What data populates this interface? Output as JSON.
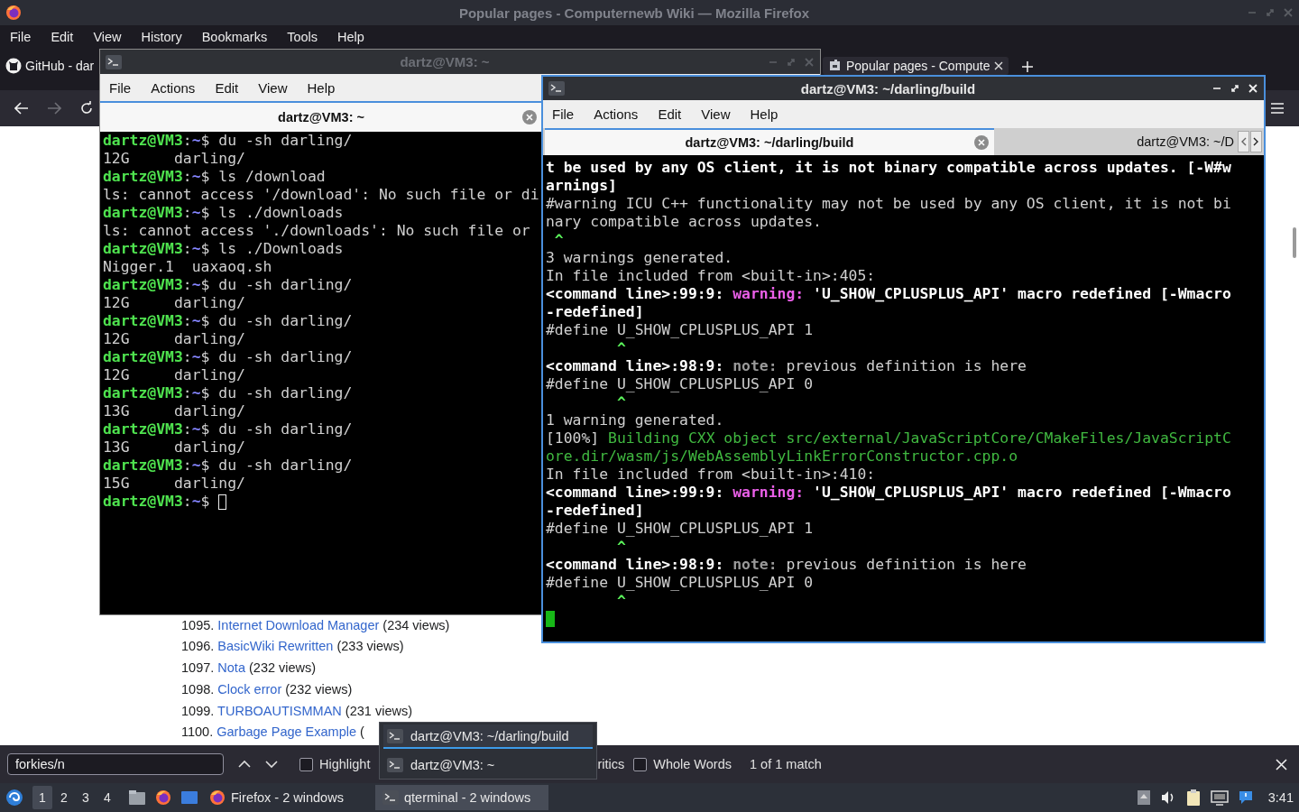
{
  "firefox": {
    "title": "Popular pages - Computernewb Wiki — Mozilla Firefox",
    "menu": [
      "File",
      "Edit",
      "View",
      "History",
      "Bookmarks",
      "Tools",
      "Help"
    ],
    "tabs": [
      {
        "label": "GitHub - dar",
        "kind": "github",
        "selected": false
      },
      {
        "label": "Popular pages - Compute",
        "kind": "wiki",
        "selected": true
      }
    ],
    "nav": {
      "forward_disabled": true
    },
    "page": {
      "items": [
        {
          "number": "1095.",
          "link": "Internet Download Manager",
          "views": "(234 views)"
        },
        {
          "number": "1096.",
          "link": "BasicWiki Rewritten",
          "views": "(233 views)"
        },
        {
          "number": "1097.",
          "link": "Nota",
          "views": "(232 views)"
        },
        {
          "number": "1098.",
          "link": "Clock error",
          "views": "(232 views)"
        },
        {
          "number": "1099.",
          "link": "TURBOAUTISMMAN",
          "views": "(231 views)"
        },
        {
          "number": "1100.",
          "link": "Garbage Page Example",
          "views": "("
        }
      ]
    },
    "find_bar": {
      "value": "forkies/n",
      "highlight": {
        "label": "Highlight",
        "checked": false
      },
      "option_fragment": "ritics",
      "whole_words": {
        "label": "Whole Words",
        "checked": false
      },
      "status": "1 of 1 match"
    }
  },
  "terminals": [
    {
      "title": "dartz@VM3: ~",
      "active": false,
      "menu": [
        "File",
        "Actions",
        "Edit",
        "View",
        "Help"
      ],
      "tabs": [
        {
          "label": "dartz@VM3: ~",
          "selected": true
        }
      ],
      "lines": [
        {
          "segs": [
            {
              "kind": "user",
              "text": "dartz@VM3"
            },
            {
              "kind": "plain",
              "text": ":"
            },
            {
              "kind": "path",
              "text": "~"
            },
            {
              "kind": "plain",
              "text": "$ du -sh darling/"
            }
          ]
        },
        {
          "segs": [
            {
              "kind": "plain",
              "text": "12G     darling/"
            }
          ]
        },
        {
          "segs": [
            {
              "kind": "user",
              "text": "dartz@VM3"
            },
            {
              "kind": "plain",
              "text": ":"
            },
            {
              "kind": "path",
              "text": "~"
            },
            {
              "kind": "plain",
              "text": "$ ls /download"
            }
          ]
        },
        {
          "segs": [
            {
              "kind": "plain",
              "text": "ls: cannot access '/download': No such file or di"
            }
          ]
        },
        {
          "segs": [
            {
              "kind": "user",
              "text": "dartz@VM3"
            },
            {
              "kind": "plain",
              "text": ":"
            },
            {
              "kind": "path",
              "text": "~"
            },
            {
              "kind": "plain",
              "text": "$ ls ./downloads"
            }
          ]
        },
        {
          "segs": [
            {
              "kind": "plain",
              "text": "ls: cannot access './downloads': No such file or"
            }
          ]
        },
        {
          "segs": [
            {
              "kind": "user",
              "text": "dartz@VM3"
            },
            {
              "kind": "plain",
              "text": ":"
            },
            {
              "kind": "path",
              "text": "~"
            },
            {
              "kind": "plain",
              "text": "$ ls ./Downloads"
            }
          ]
        },
        {
          "segs": [
            {
              "kind": "plain",
              "text": "Nigger.1  uaxaoq.sh"
            }
          ]
        },
        {
          "segs": [
            {
              "kind": "user",
              "text": "dartz@VM3"
            },
            {
              "kind": "plain",
              "text": ":"
            },
            {
              "kind": "path",
              "text": "~"
            },
            {
              "kind": "plain",
              "text": "$ du -sh darling/"
            }
          ]
        },
        {
          "segs": [
            {
              "kind": "plain",
              "text": "12G     darling/"
            }
          ]
        },
        {
          "segs": [
            {
              "kind": "user",
              "text": "dartz@VM3"
            },
            {
              "kind": "plain",
              "text": ":"
            },
            {
              "kind": "path",
              "text": "~"
            },
            {
              "kind": "plain",
              "text": "$ du -sh darling/"
            }
          ]
        },
        {
          "segs": [
            {
              "kind": "plain",
              "text": "12G     darling/"
            }
          ]
        },
        {
          "segs": [
            {
              "kind": "user",
              "text": "dartz@VM3"
            },
            {
              "kind": "plain",
              "text": ":"
            },
            {
              "kind": "path",
              "text": "~"
            },
            {
              "kind": "plain",
              "text": "$ du -sh darling/"
            }
          ]
        },
        {
          "segs": [
            {
              "kind": "plain",
              "text": "12G     darling/"
            }
          ]
        },
        {
          "segs": [
            {
              "kind": "user",
              "text": "dartz@VM3"
            },
            {
              "kind": "plain",
              "text": ":"
            },
            {
              "kind": "path",
              "text": "~"
            },
            {
              "kind": "plain",
              "text": "$ du -sh darling/"
            }
          ]
        },
        {
          "segs": [
            {
              "kind": "plain",
              "text": "13G     darling/"
            }
          ]
        },
        {
          "segs": [
            {
              "kind": "user",
              "text": "dartz@VM3"
            },
            {
              "kind": "plain",
              "text": ":"
            },
            {
              "kind": "path",
              "text": "~"
            },
            {
              "kind": "plain",
              "text": "$ du -sh darling/"
            }
          ]
        },
        {
          "segs": [
            {
              "kind": "plain",
              "text": "13G     darling/"
            }
          ]
        },
        {
          "segs": [
            {
              "kind": "user",
              "text": "dartz@VM3"
            },
            {
              "kind": "plain",
              "text": ":"
            },
            {
              "kind": "path",
              "text": "~"
            },
            {
              "kind": "plain",
              "text": "$ du -sh darling/"
            }
          ]
        },
        {
          "segs": [
            {
              "kind": "plain",
              "text": "15G     darling/"
            }
          ]
        },
        {
          "segs": [
            {
              "kind": "user",
              "text": "dartz@VM3"
            },
            {
              "kind": "plain",
              "text": ":"
            },
            {
              "kind": "path",
              "text": "~"
            },
            {
              "kind": "plain",
              "text": "$ "
            },
            {
              "kind": "hollow_cursor"
            }
          ]
        }
      ]
    },
    {
      "title": "dartz@VM3: ~/darling/build",
      "active": true,
      "menu": [
        "File",
        "Actions",
        "Edit",
        "View",
        "Help"
      ],
      "tabs": [
        {
          "label": "dartz@VM3: ~/darling/build",
          "selected": true
        },
        {
          "label": "dartz@VM3: ~/D",
          "selected": false
        }
      ],
      "lines": [
        {
          "segs": [
            {
              "kind": "bold",
              "text": "t be used by any OS client, it is not binary compatible across updates. [-W#w"
            }
          ]
        },
        {
          "segs": [
            {
              "kind": "bold",
              "text": "arnings]"
            }
          ]
        },
        {
          "segs": [
            {
              "kind": "plain",
              "text": "#warning ICU C++ functionality may not be used by any OS client, it is not bi"
            }
          ]
        },
        {
          "segs": [
            {
              "kind": "plain",
              "text": "nary compatible across updates."
            }
          ]
        },
        {
          "segs": [
            {
              "kind": "caret",
              "text": " ^"
            }
          ]
        },
        {
          "segs": [
            {
              "kind": "plain",
              "text": "3 warnings generated."
            }
          ]
        },
        {
          "segs": [
            {
              "kind": "plain",
              "text": "In file included from <built-in>:405:"
            }
          ]
        },
        {
          "segs": [
            {
              "kind": "bold",
              "text": "<command line>:99:9: "
            },
            {
              "kind": "warning",
              "text": "warning:"
            },
            {
              "kind": "bold",
              "text": " 'U_SHOW_CPLUSPLUS_API' macro redefined [-Wmacro"
            }
          ]
        },
        {
          "segs": [
            {
              "kind": "bold",
              "text": "-redefined]"
            }
          ]
        },
        {
          "segs": [
            {
              "kind": "plain",
              "text": "#define U_SHOW_CPLUSPLUS_API 1"
            }
          ]
        },
        {
          "segs": [
            {
              "kind": "caret",
              "text": "        ^"
            }
          ]
        },
        {
          "segs": [
            {
              "kind": "bold",
              "text": "<command line>:98:9: "
            },
            {
              "kind": "note",
              "text": "note:"
            },
            {
              "kind": "plain",
              "text": " previous definition is here"
            }
          ]
        },
        {
          "segs": [
            {
              "kind": "plain",
              "text": "#define U_SHOW_CPLUSPLUS_API 0"
            }
          ]
        },
        {
          "segs": [
            {
              "kind": "caret",
              "text": "        ^"
            }
          ]
        },
        {
          "segs": [
            {
              "kind": "plain",
              "text": "1 warning generated."
            }
          ]
        },
        {
          "segs": [
            {
              "kind": "plain",
              "text": "[100%] "
            },
            {
              "kind": "green",
              "text": "Building CXX object src/external/JavaScriptCore/CMakeFiles/JavaScriptC"
            }
          ]
        },
        {
          "segs": [
            {
              "kind": "green",
              "text": "ore.dir/wasm/js/WebAssemblyLinkErrorConstructor.cpp.o"
            }
          ]
        },
        {
          "segs": [
            {
              "kind": "plain",
              "text": "In file included from <built-in>:410:"
            }
          ]
        },
        {
          "segs": [
            {
              "kind": "bold",
              "text": "<command line>:99:9: "
            },
            {
              "kind": "warning",
              "text": "warning:"
            },
            {
              "kind": "bold",
              "text": " 'U_SHOW_CPLUSPLUS_API' macro redefined [-Wmacro"
            }
          ]
        },
        {
          "segs": [
            {
              "kind": "bold",
              "text": "-redefined]"
            }
          ]
        },
        {
          "segs": [
            {
              "kind": "plain",
              "text": "#define U_SHOW_CPLUSPLUS_API 1"
            }
          ]
        },
        {
          "segs": [
            {
              "kind": "caret",
              "text": "        ^"
            }
          ]
        },
        {
          "segs": [
            {
              "kind": "bold",
              "text": "<command line>:98:9: "
            },
            {
              "kind": "note",
              "text": "note:"
            },
            {
              "kind": "plain",
              "text": " previous definition is here"
            }
          ]
        },
        {
          "segs": [
            {
              "kind": "plain",
              "text": "#define U_SHOW_CPLUSPLUS_API 0"
            }
          ]
        },
        {
          "segs": [
            {
              "kind": "caret",
              "text": "        ^"
            }
          ]
        },
        {
          "segs": [
            {
              "kind": "block_cursor"
            }
          ]
        }
      ]
    }
  ],
  "window_list": {
    "items": [
      {
        "label": "dartz@VM3: ~/darling/build",
        "selected": true
      },
      {
        "label": "dartz@VM3: ~",
        "selected": false
      }
    ]
  },
  "taskbar": {
    "workspaces": [
      {
        "label": "1",
        "selected": true
      },
      {
        "label": "2",
        "selected": false
      },
      {
        "label": "3",
        "selected": false
      },
      {
        "label": "4",
        "selected": false
      }
    ],
    "tasks": [
      {
        "label": "Firefox - 2 windows",
        "kind": "browser",
        "selected": false
      },
      {
        "label": "qterminal - 2 windows",
        "kind": "terminal",
        "selected": true
      }
    ],
    "clock": "3:41"
  }
}
